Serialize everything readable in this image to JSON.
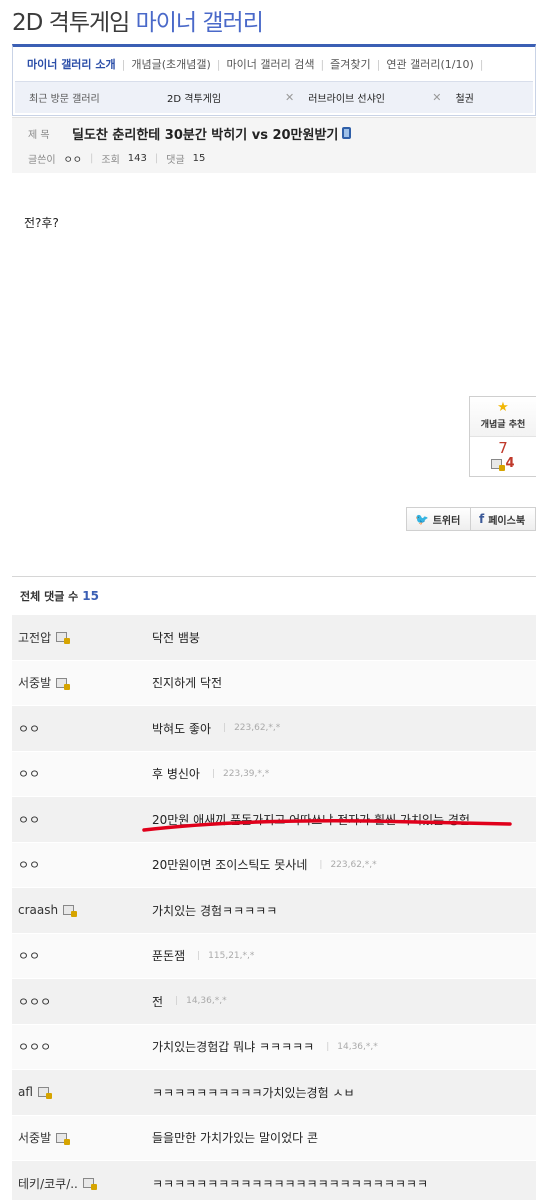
{
  "gallery": {
    "title_dark": "2D 격투게임",
    "title_blue": "마이너 갤러리"
  },
  "nav": {
    "items": [
      "마이너 갤러리 소개",
      "개념글(초개념갤)",
      "마이너 갤러리 검색",
      "즐겨찾기",
      "연관 갤러리(1/10)"
    ],
    "recent_label": "최근 방문 갤러리",
    "recent": [
      "2D 격투게임",
      "러브라이브 선샤인",
      "철권"
    ],
    "close_symbol": "✕"
  },
  "post": {
    "subject_label": "제 목",
    "title": "딜도찬 춘리한테 30분간 박히기 vs 20만원받기",
    "writer_label": "글쓴이",
    "writer": "ㅇㅇ",
    "views_label": "조회",
    "views": "143",
    "comments_label": "댓글",
    "comments": "15",
    "body": "전?후?"
  },
  "recommend": {
    "label": "개념글 추천",
    "count": "7",
    "fixed_count": "4"
  },
  "share": {
    "twitter": "트위터",
    "facebook": "페이스북"
  },
  "comment_header": {
    "label": "전체 댓글 수",
    "count": "15"
  },
  "comments": [
    {
      "author": "고전압",
      "fixed": true,
      "text": "닥전 뱀붕",
      "ip": ""
    },
    {
      "author": "서중발",
      "fixed": true,
      "text": "진지하게 닥전",
      "ip": ""
    },
    {
      "author": "ㅇㅇ",
      "fixed": false,
      "text": "박혀도 좋아",
      "ip": "223,62,*,*"
    },
    {
      "author": "ㅇㅇ",
      "fixed": false,
      "text": "후 병신아",
      "ip": "223,39,*,*"
    },
    {
      "author": "ㅇㅇ",
      "fixed": false,
      "text": "20만원 애새끼 푼돈가지고 어따쓰냐 전자가 훨씬 가치있는 경험",
      "ip": ""
    },
    {
      "author": "ㅇㅇ",
      "fixed": false,
      "text": "20만원이면 조이스틱도 못사네",
      "ip": "223,62,*,*"
    },
    {
      "author": "craash",
      "fixed": true,
      "text": "가치있는 경험ㅋㅋㅋㅋㅋ",
      "ip": ""
    },
    {
      "author": "ㅇㅇ",
      "fixed": false,
      "text": "푼돈잼",
      "ip": "115,21,*,*"
    },
    {
      "author": "ㅇㅇㅇ",
      "fixed": false,
      "text": "전",
      "ip": "14,36,*,*"
    },
    {
      "author": "ㅇㅇㅇ",
      "fixed": false,
      "text": "가치있는경험갑 뭐냐 ㅋㅋㅋㅋㅋ",
      "ip": "14,36,*,*"
    },
    {
      "author": "afl",
      "fixed": true,
      "text": "ㅋㅋㅋㅋㅋㅋㅋㅋㅋㅋ가치있는경험 ㅅㅂ",
      "ip": ""
    },
    {
      "author": "서중발",
      "fixed": true,
      "text": "들을만한 가치가있는 말이었다 콘",
      "ip": ""
    },
    {
      "author": "테키/코쿠/..",
      "fixed": true,
      "text": "ㅋㅋㅋㅋㅋㅋㅋㅋㅋㅋㅋㅋㅋㅋㅋㅋㅋㅋㅋㅋㅋㅋㅋㅋㅋ",
      "ip": ""
    }
  ],
  "colors": {
    "accent": "#3b5fb4",
    "highlight_stroke": "#e0001b"
  }
}
